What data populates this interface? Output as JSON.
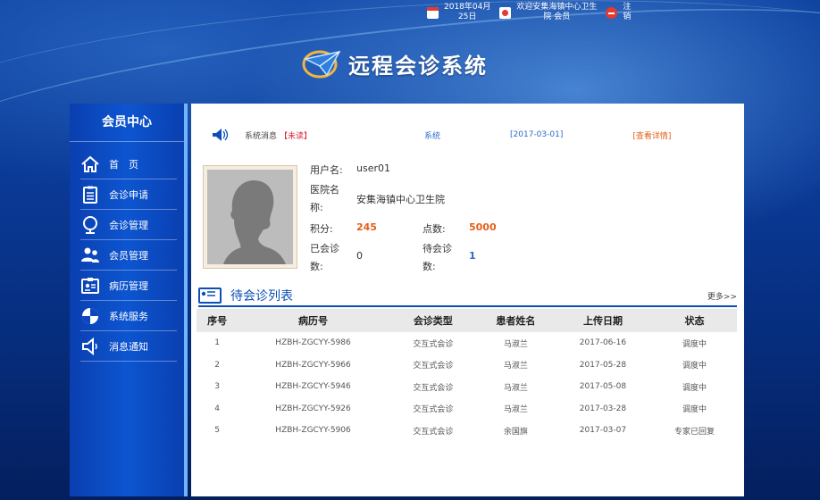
{
  "topbar": {
    "date_line1": "2018年04月",
    "date_line2": "25日",
    "welcome_line1": "欢迎安集海镇中心卫生",
    "welcome_line2": "院 会员",
    "logout_line1": "注",
    "logout_line2": "销"
  },
  "header": {
    "title": "远程会诊系统"
  },
  "sidebar": {
    "title": "会员中心",
    "items": [
      {
        "label": "首　页",
        "icon": "home-icon"
      },
      {
        "label": "会诊申请",
        "icon": "clipboard-icon"
      },
      {
        "label": "会诊管理",
        "icon": "globe-icon"
      },
      {
        "label": "会员管理",
        "icon": "users-icon"
      },
      {
        "label": "病历管理",
        "icon": "id-card-icon"
      },
      {
        "label": "系统服务",
        "icon": "shield-icon"
      },
      {
        "label": "消息通知",
        "icon": "speaker-icon"
      }
    ]
  },
  "message": {
    "label": "系统消息",
    "unread": "【未读】",
    "type": "系统",
    "date": "[2017-03-01]",
    "detail": "[查看详情]"
  },
  "profile": {
    "username_label": "用户名:",
    "username": "user01",
    "hospital_label_1": "医院名",
    "hospital_label_2": "称:",
    "hospital": "安集海镇中心卫生院",
    "points_label": "积分:",
    "points": "245",
    "credits_label": "点数:",
    "credits": "5000",
    "consulted_label_1": "已会诊",
    "consulted_label_2": "数:",
    "consulted": "0",
    "pending_label_1": "待会诊",
    "pending_label_2": "数:",
    "pending": "1"
  },
  "pending_list": {
    "title": "待会诊列表",
    "more": "更多>>",
    "columns": [
      "序号",
      "病历号",
      "会诊类型",
      "患者姓名",
      "上传日期",
      "状态"
    ],
    "rows": [
      [
        "1",
        "HZBH-ZGCYY-5986",
        "交互式会诊",
        "马淑兰",
        "2017-06-16",
        "调度中"
      ],
      [
        "2",
        "HZBH-ZGCYY-5966",
        "交互式会诊",
        "马淑兰",
        "2017-05-28",
        "调度中"
      ],
      [
        "3",
        "HZBH-ZGCYY-5946",
        "交互式会诊",
        "马淑兰",
        "2017-05-08",
        "调度中"
      ],
      [
        "4",
        "HZBH-ZGCYY-5926",
        "交互式会诊",
        "马淑兰",
        "2017-03-28",
        "调度中"
      ],
      [
        "5",
        "HZBH-ZGCYY-5906",
        "交互式会诊",
        "余国旗",
        "2017-03-07",
        "专家已回复"
      ]
    ]
  },
  "colors": {
    "accent_blue": "#0d4fb5",
    "highlight_orange": "#e3601b",
    "unread_red": "#dd2233",
    "link_blue": "#2b6cc4"
  }
}
